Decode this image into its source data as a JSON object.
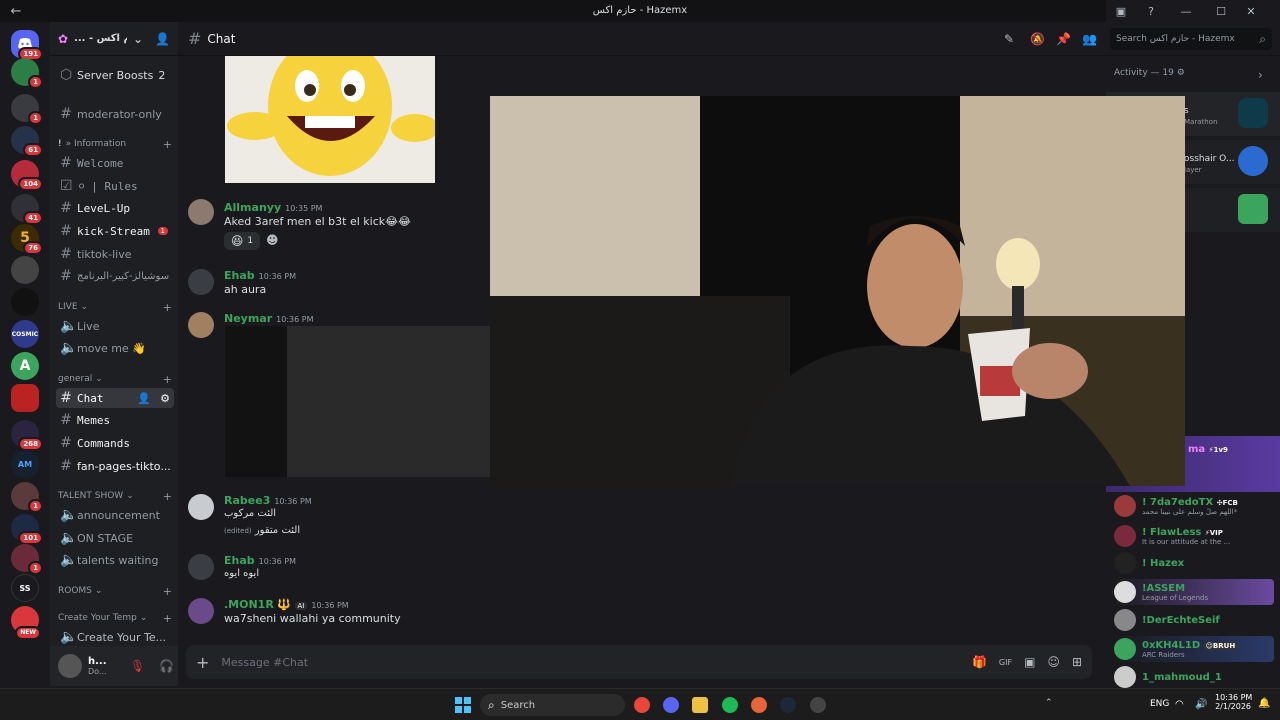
{
  "window": {
    "title": "حازم اكس - Hazemx"
  },
  "servers": [
    {
      "name": "discord-home",
      "badge": "191"
    },
    {
      "name": "server-1",
      "badge": "1"
    },
    {
      "name": "server-2",
      "badge": "1"
    },
    {
      "name": "server-3",
      "badge": "61"
    },
    {
      "name": "server-4",
      "badge": "104"
    },
    {
      "name": "server-5",
      "badge": "41"
    },
    {
      "name": "server-6",
      "badge": "76"
    },
    {
      "name": "server-7",
      "badge": ""
    },
    {
      "name": "server-8",
      "badge": ""
    },
    {
      "name": "server-cosmic",
      "badge": ""
    },
    {
      "name": "server-a",
      "badge": ""
    },
    {
      "name": "server-10",
      "badge": ""
    },
    {
      "name": "server-11",
      "badge": "268"
    },
    {
      "name": "server-12",
      "badge": ""
    },
    {
      "name": "server-13",
      "badge": "1"
    },
    {
      "name": "server-14",
      "badge": "101"
    },
    {
      "name": "server-15",
      "badge": "1"
    },
    {
      "name": "server-ss",
      "badge": ""
    },
    {
      "name": "server-new",
      "badge": "NEW"
    }
  ],
  "guild": {
    "name": "... - حازم اكس"
  },
  "channels": {
    "server_boosts": "Server Boosts",
    "server_boosts_count": "2",
    "moderator_only": "moderator-only",
    "information_cat": "» Information",
    "welcome": "Welcome",
    "rules": "| Rules",
    "level_up": "LeveL-Up",
    "kick_stream": "kick-Stream",
    "kick_stream_badge": "1",
    "tiktok_live": "tiktok-live",
    "social": "سوشيالز-كبير-البرنامج",
    "live_cat": "LIVE",
    "live": "Live",
    "move_me": "move me 👋",
    "general_cat": "general",
    "chat": "Chat",
    "memes": "Memes",
    "commands": "Commands",
    "fan_pages": "fan-pages-tikto...",
    "talent_cat": "TALENT SHOW",
    "announcement": "announcement",
    "on_stage": "ON STAGE",
    "talents_waiting": "talents waiting",
    "rooms_cat": "ROOMS",
    "create_temp_cat": "Create Your Temp",
    "create_your_te": "Create Your Te..."
  },
  "user": {
    "name": "h...",
    "status": "Do..."
  },
  "topbar": {
    "channel": "Chat",
    "search_placeholder": "Search حازم اكس - Hazemx"
  },
  "messages": [
    {
      "user": "Allmanyy",
      "time": "10:35 PM",
      "text": "Aked 3aref men el b3t el kick😂😂",
      "reaction": "😆",
      "reaction_count": "1"
    },
    {
      "user": "Ehab",
      "time": "10:36 PM",
      "text": "ah aura"
    },
    {
      "user": "Neymar",
      "time": "10:36 PM",
      "text": ""
    },
    {
      "user": "Rabee3",
      "time": "10:36 PM",
      "text": "الئت مركوب",
      "text2": "الئت متقور",
      "edited": "(edited)"
    },
    {
      "user": "Ehab",
      "time": "10:36 PM",
      "text": "ايوه ايوه"
    },
    {
      "user": ".MON1R",
      "time": "10:36 PM",
      "text": "wa7sheni wallahi ya community",
      "tag": "AI",
      "emoji": "🔱"
    }
  ],
  "composer": {
    "placeholder": "Message #Chat"
  },
  "activity": {
    "label": "Activity — 19",
    "items": [
      {
        "title": "s",
        "sub": "Marathon"
      },
      {
        "title": "osshair O...",
        "sub": "layer"
      },
      {
        "title": "",
        "sub": ""
      }
    ]
  },
  "members": [
    {
      "name": "ma",
      "tag": "1v9"
    },
    {
      "name": "! 7da7edoTX",
      "tag": "FCB",
      "status": "اللهم صلِّ وسلم على نبينا محمد*"
    },
    {
      "name": "! FlawLess",
      "tag": "VIP",
      "status": "It is our attitude at the ..."
    },
    {
      "name": "! Hazex",
      "tag": "",
      "status": ""
    },
    {
      "name": "!ASSEM",
      "tag": "",
      "status": "League of Legends"
    },
    {
      "name": "!DerEchteSeif",
      "tag": "",
      "status": ""
    },
    {
      "name": "0xKH4L1D",
      "tag": "BRUH",
      "status": "ARC Raiders"
    },
    {
      "name": "1_mahmoud_1",
      "tag": "",
      "status": ""
    }
  ],
  "taskbar": {
    "search": "Search",
    "lang": "ENG",
    "time": "10:36 PM",
    "date": "2/1/2026"
  },
  "colors": {
    "accent": "#5865f2",
    "green": "#3ba55d",
    "red": "#da373c",
    "bg": "#1a1a1e"
  }
}
